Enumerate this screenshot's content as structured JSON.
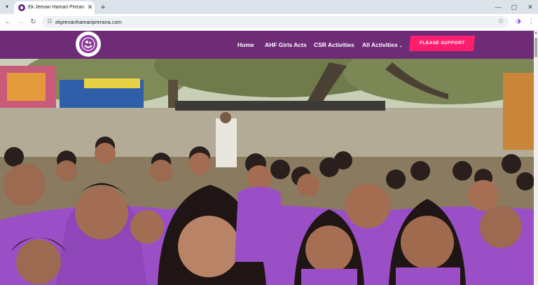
{
  "browser": {
    "tab_title": "Ek Jeevan Hamari Prerana – Ek",
    "url": "ekjeevanhamariprerana.com",
    "icons": [
      "tab-search-icon",
      "favicon-icon",
      "close-icon",
      "plus-icon",
      "minimize-icon",
      "maximize-icon",
      "close-window-icon",
      "back-icon",
      "forward-icon",
      "reload-icon",
      "site-info-icon",
      "star-icon",
      "extension-icon",
      "more-menu-icon"
    ]
  },
  "site": {
    "logo_icon": "ek-jeevan-logo",
    "nav": {
      "home": "Home",
      "girls_acts": "AHF Girls Acts",
      "csr": "CSR Activities",
      "all": "All Activities"
    },
    "support_button": "PLEASE SUPPORT",
    "colors": {
      "header": "#6e2c77",
      "support": "#ff1e6e",
      "shirt": "#9b4fc6"
    },
    "hero_image": "group photo of girls and women in purple shirts outdoors under trees"
  }
}
